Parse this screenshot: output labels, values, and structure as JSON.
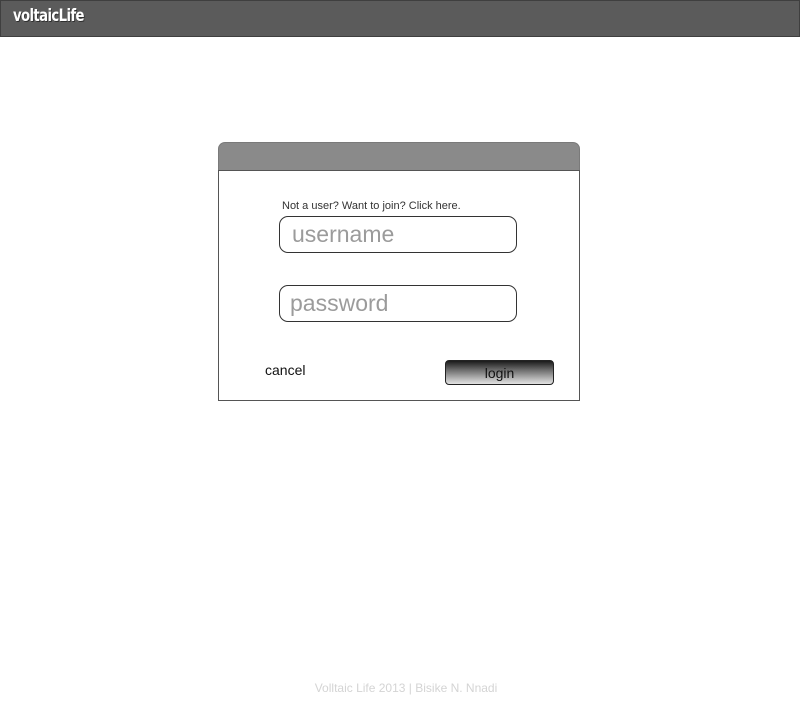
{
  "header": {
    "brand": "voltaicLife"
  },
  "login_dialog": {
    "join_link": "Not a user? Want to join? Click here.",
    "username_placeholder": "username",
    "password_placeholder": "password",
    "cancel_label": "cancel",
    "login_label": "login"
  },
  "footer": {
    "text": "Volltaic Life 2013 | Bisike N. Nnadi"
  },
  "colors": {
    "topbar": "#5b5b5b",
    "dialog_header": "#8a8a8a",
    "placeholder_text": "#9b9b9b",
    "footer_text": "#d4d4d4"
  }
}
